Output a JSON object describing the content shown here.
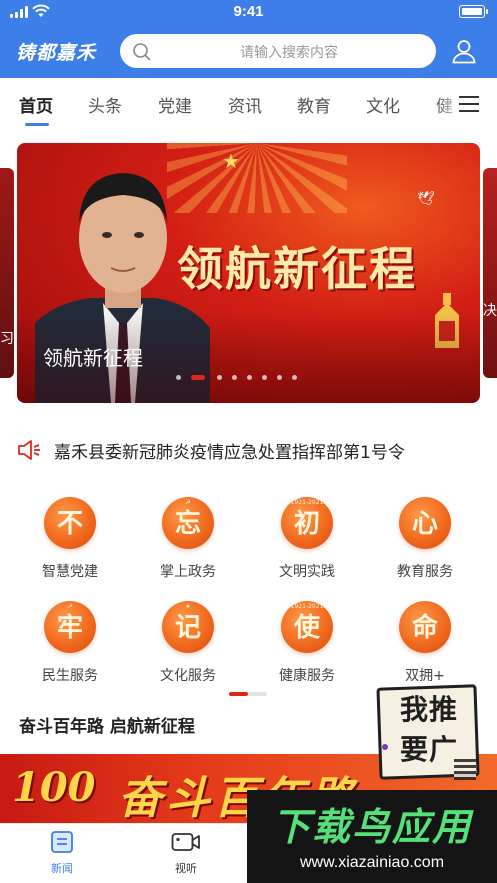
{
  "status_bar": {
    "time": "9:41"
  },
  "header": {
    "brand": "铸都嘉禾",
    "search_placeholder": "请输入搜索内容",
    "accent_color": "#3d7ee8"
  },
  "tabs": [
    {
      "label": "首页",
      "active": true
    },
    {
      "label": "头条",
      "active": false
    },
    {
      "label": "党建",
      "active": false
    },
    {
      "label": "资讯",
      "active": false
    },
    {
      "label": "教育",
      "active": false
    },
    {
      "label": "文化",
      "active": false
    },
    {
      "label": "健",
      "active": false
    }
  ],
  "banner": {
    "headline": "领航新征程",
    "caption": "领航新征程",
    "left_peek_text": "习",
    "right_peek_text": "决",
    "slide_count": 8,
    "active_slide": 1
  },
  "notice": {
    "icon": "speaker-icon",
    "text": "嘉禾县委新冠肺炎疫情应急处置指挥部第1号令"
  },
  "services": [
    {
      "char": "不",
      "label": "智慧党建",
      "mark": ""
    },
    {
      "char": "忘",
      "label": "掌上政务",
      "mark": "☭"
    },
    {
      "char": "初",
      "label": "文明实践",
      "mark": "1921-2021"
    },
    {
      "char": "心",
      "label": "教育服务",
      "mark": ""
    },
    {
      "char": "牢",
      "label": "民生服务",
      "mark": "☭"
    },
    {
      "char": "记",
      "label": "文化服务",
      "mark": "★"
    },
    {
      "char": "使",
      "label": "健康服务",
      "mark": "1921-2021"
    },
    {
      "char": "命",
      "label": "双拥+",
      "mark": ""
    }
  ],
  "section": {
    "title": "奋斗百年路 启航新征程"
  },
  "promo": {
    "number": "100",
    "text": "奋斗百年路"
  },
  "float_ad": {
    "line1": "我推",
    "line2": "要广"
  },
  "tabbar": [
    {
      "label": "新闻",
      "icon": "news-icon",
      "active": true
    },
    {
      "label": "视听",
      "icon": "video-icon",
      "active": false
    }
  ],
  "watermark": {
    "title": "下载鸟应用",
    "url": "www.xiazainiao.com"
  },
  "colors": {
    "active_tab": "#3d7ee8",
    "service_badge": "#f06a1e",
    "notice_icon": "#e0261b"
  }
}
